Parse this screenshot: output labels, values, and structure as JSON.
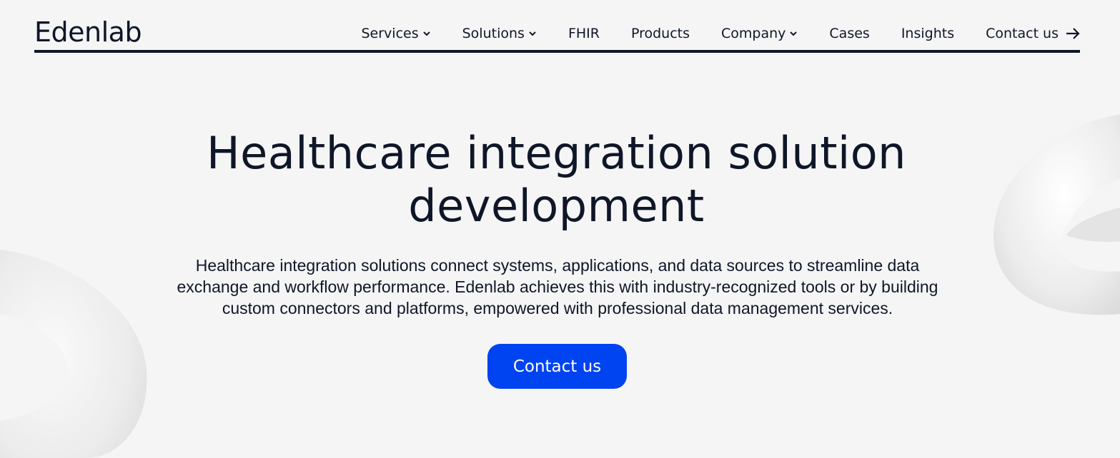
{
  "header": {
    "logo": "Edenlab",
    "nav": [
      {
        "label": "Services",
        "dropdown": true
      },
      {
        "label": "Solutions",
        "dropdown": true
      },
      {
        "label": "FHIR",
        "dropdown": false
      },
      {
        "label": "Products",
        "dropdown": false
      },
      {
        "label": "Company",
        "dropdown": true
      },
      {
        "label": "Cases",
        "dropdown": false
      },
      {
        "label": "Insights",
        "dropdown": false
      },
      {
        "label": "Contact us",
        "dropdown": false,
        "icon": "arrow-right-icon"
      }
    ]
  },
  "hero": {
    "title_line1": "Healthcare integration solution",
    "title_line2": "development",
    "description_line1": "Healthcare integration solutions connect systems, applications, and data sources to streamline data",
    "description_line2": "exchange and workflow performance. Edenlab achieves this with industry-recognized tools or by building",
    "description_line3": "custom connectors and platforms, empowered with professional data management services.",
    "cta_label": "Contact us"
  },
  "colors": {
    "background": "#f5f5f5",
    "text": "#0f1628",
    "accent": "#0043f0",
    "cta_text": "#ffffff"
  }
}
